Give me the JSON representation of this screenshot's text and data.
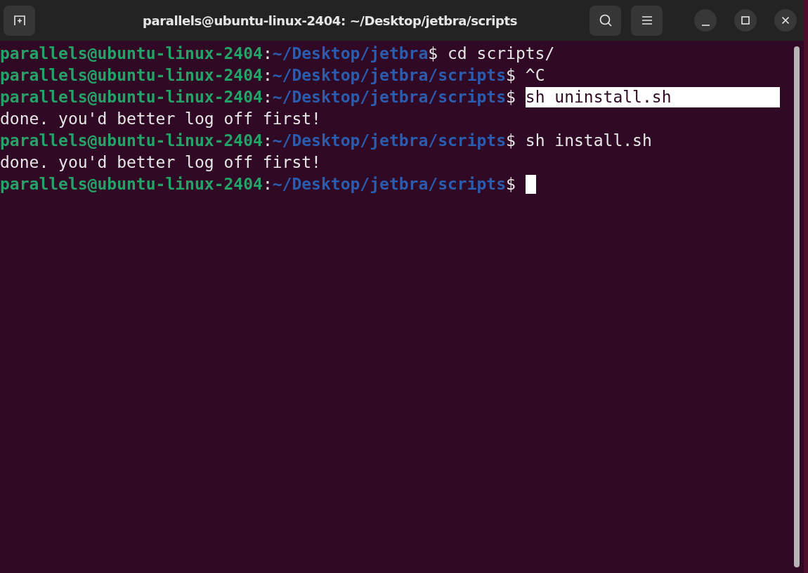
{
  "window": {
    "title": "parallels@ubuntu-linux-2404: ~/Desktop/jetbra/scripts"
  },
  "lines": [
    {
      "kind": "prompt",
      "user": "parallels@ubuntu-linux-2404",
      "colon": ":",
      "path": "~/Desktop/jetbra",
      "sign": "$",
      "command": "cd scripts/",
      "selected": false,
      "cursor": false
    },
    {
      "kind": "prompt",
      "user": "parallels@ubuntu-linux-2404",
      "colon": ":",
      "path": "~/Desktop/jetbra/scripts",
      "sign": "$",
      "command": "^C",
      "selected": false,
      "cursor": false
    },
    {
      "kind": "prompt",
      "user": "parallels@ubuntu-linux-2404",
      "colon": ":",
      "path": "~/Desktop/jetbra/scripts",
      "sign": "$",
      "command": "sh uninstall.sh",
      "selected": true,
      "cursor": false
    },
    {
      "kind": "output",
      "text": "done. you'd better log off first!"
    },
    {
      "kind": "prompt",
      "user": "parallels@ubuntu-linux-2404",
      "colon": ":",
      "path": "~/Desktop/jetbra/scripts",
      "sign": "$",
      "command": "sh install.sh",
      "selected": false,
      "cursor": false
    },
    {
      "kind": "output",
      "text": "done. you'd better log off first!"
    },
    {
      "kind": "prompt",
      "user": "parallels@ubuntu-linux-2404",
      "colon": ":",
      "path": "~/Desktop/jetbra/scripts",
      "sign": "$",
      "cursor": true
    }
  ]
}
